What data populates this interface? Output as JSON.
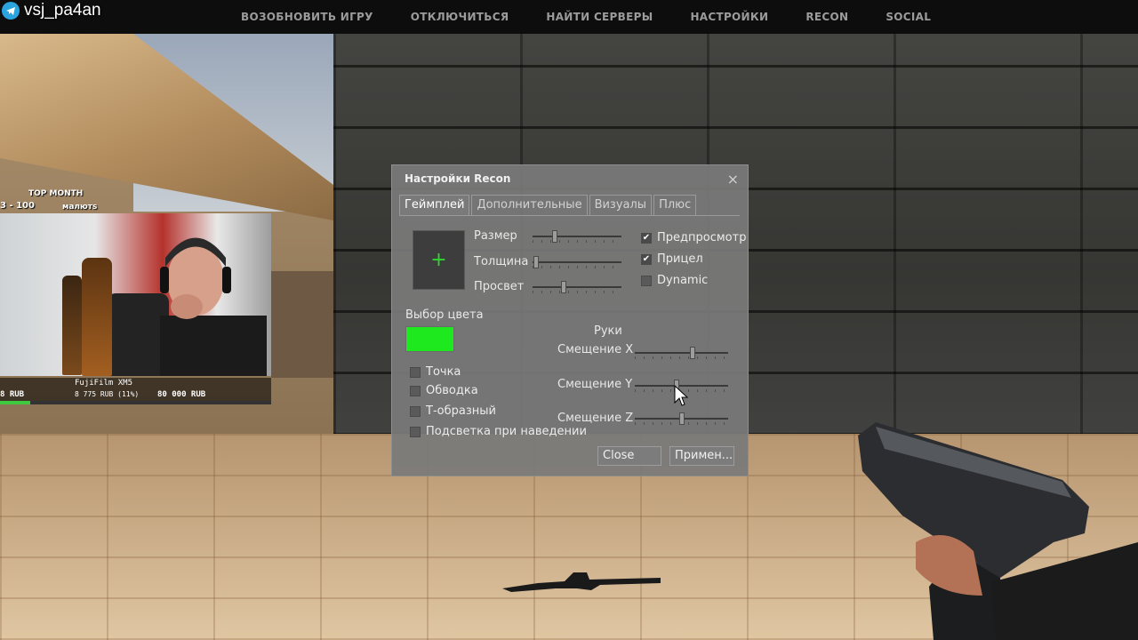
{
  "topbar": {
    "menu": [
      "ВОЗОБНОВИТЬ ИГРУ",
      "ОТКЛЮЧИТЬСЯ",
      "НАЙТИ СЕРВЕРЫ",
      "НАСТРОЙКИ",
      "RECON",
      "SOCIAL"
    ]
  },
  "stream": {
    "channel_name": "vsj_pa4an",
    "channel_icon": "telegram-icon",
    "top_month_label": "TOP MONTH",
    "top_donor_left": "3 - 100",
    "top_donor_right": "малютs",
    "goal_title": "FujiFilm XM5",
    "goal_left": "8 RUB",
    "goal_current": "8 775 RUB (11%)",
    "goal_target": "80 000 RUB",
    "goal_progress": 0.11,
    "goal_color": "#3ec93e"
  },
  "dialog": {
    "title": "Настройки Recon",
    "close_symbol": "×",
    "tabs": [
      {
        "label": "Геймплей",
        "active": true
      },
      {
        "label": "Дополнительные",
        "active": false
      },
      {
        "label": "Визуалы",
        "active": false
      },
      {
        "label": "Плюс",
        "active": false
      }
    ],
    "crosshair_preview_symbol": "+",
    "crosshair_color": "#2fd62f",
    "sliders": {
      "size_label": "Размер",
      "size_value": 0.25,
      "thickness_label": "Толщина",
      "thickness_value": 0.04,
      "opacity_label": "Просвет",
      "opacity_value": 0.35
    },
    "toggles": [
      {
        "label": "Предпросмотр",
        "checked": true
      },
      {
        "label": "Прицел",
        "checked": true
      },
      {
        "label": "Dynamic",
        "checked": false
      }
    ],
    "color_pick_label": "Выбор цвета",
    "selected_color": "#1ee81e",
    "options": [
      {
        "label": "Точка",
        "checked": false
      },
      {
        "label": "Обводка",
        "checked": false
      },
      {
        "label": "Т-образный",
        "checked": false
      },
      {
        "label": "Подсветка при наведении",
        "checked": false
      }
    ],
    "hands": {
      "label": "Руки",
      "offset_x_label": "Смещение X",
      "offset_x_value": 0.62,
      "offset_y_label": "Смещение Y",
      "offset_y_value": 0.45,
      "offset_z_label": "Смещение Z",
      "offset_z_value": 0.5
    },
    "close_button": "Close",
    "apply_button": "Примен..."
  }
}
